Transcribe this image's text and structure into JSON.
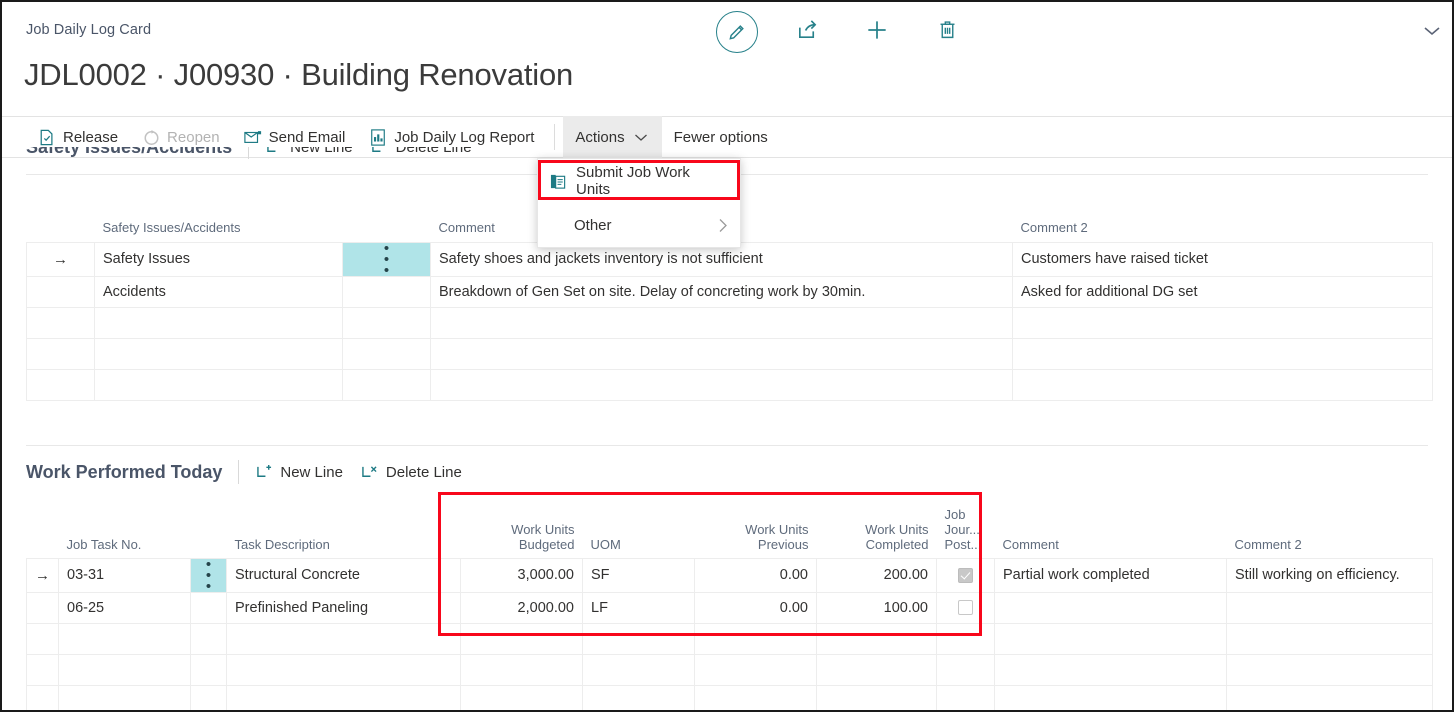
{
  "header": {
    "breadcrumb": "Job Daily Log Card",
    "title": "JDL0002 · J00930 · Building Renovation",
    "icons": [
      {
        "name": "edit-icon",
        "label": "Edit"
      },
      {
        "name": "share-icon",
        "label": "Share"
      },
      {
        "name": "plus-icon",
        "label": "New"
      },
      {
        "name": "trash-icon",
        "label": "Delete"
      }
    ],
    "collapse_icon": "chevron-down-icon"
  },
  "ribbon": {
    "items": [
      {
        "label": "Release",
        "icon": "release-icon",
        "disabled": false
      },
      {
        "label": "Reopen",
        "icon": "reopen-icon",
        "disabled": true
      },
      {
        "label": "Send Email",
        "icon": "email-icon",
        "disabled": false
      },
      {
        "label": "Job Daily Log Report",
        "icon": "report-icon",
        "disabled": false
      }
    ],
    "actions_label": "Actions",
    "fewer_options_label": "Fewer options"
  },
  "actions_menu": {
    "items": [
      {
        "label": "Submit Job Work Units",
        "icon": "submit-document-icon",
        "highlighted": true,
        "has_submenu": false
      },
      {
        "label": "Other",
        "icon": "",
        "highlighted": false,
        "has_submenu": true
      }
    ],
    "highlight_color": "#f8071b"
  },
  "safety_section": {
    "title": "Safety Issues/Accidents",
    "new_line_label": "New Line",
    "delete_line_label": "Delete Line",
    "columns": [
      "",
      "Safety Issues/Accidents",
      "",
      "Comment",
      "Comment 2"
    ],
    "rows": [
      {
        "selected": true,
        "issue": "Safety Issues",
        "comment": "Safety shoes and jackets inventory is not sufficient",
        "comment2": "Customers have raised ticket"
      },
      {
        "selected": false,
        "issue": "Accidents",
        "comment": "Breakdown of Gen Set on site. Delay of concreting work by 30min.",
        "comment2": "Asked for additional DG set"
      },
      {
        "selected": false,
        "issue": "",
        "comment": "",
        "comment2": ""
      },
      {
        "selected": false,
        "issue": "",
        "comment": "",
        "comment2": ""
      },
      {
        "selected": false,
        "issue": "",
        "comment": "",
        "comment2": ""
      }
    ]
  },
  "work_section": {
    "title": "Work Performed Today",
    "new_line_label": "New Line",
    "delete_line_label": "Delete Line",
    "columns": {
      "job_task_no": "Job Task No.",
      "task_description": "Task Description",
      "work_units_budgeted": "Work Units\nBudgeted",
      "work_units_budgeted_l1": "Work Units",
      "work_units_budgeted_l2": "Budgeted",
      "uom": "UOM",
      "work_units_previous_l1": "Work Units",
      "work_units_previous_l2": "Previous",
      "work_units_completed_l1": "Work Units",
      "work_units_completed_l2": "Completed",
      "job_journal_posted_l1": "Job",
      "job_journal_posted_l2": "Jour...",
      "job_journal_posted_l3": "Post...",
      "comment": "Comment",
      "comment2": "Comment 2"
    },
    "rows": [
      {
        "selected": true,
        "job_task_no": "03-31",
        "task_description": "Structural Concrete",
        "work_units_budgeted": "3,000.00",
        "uom": "SF",
        "work_units_previous": "0.00",
        "work_units_completed": "200.00",
        "job_journal_posted": true,
        "comment": "Partial work completed",
        "comment2": "Still working on efficiency."
      },
      {
        "selected": false,
        "job_task_no": "06-25",
        "task_description": "Prefinished Paneling",
        "work_units_budgeted": "2,000.00",
        "uom": "LF",
        "work_units_previous": "0.00",
        "work_units_completed": "100.00",
        "job_journal_posted": false,
        "comment": "",
        "comment2": ""
      },
      {
        "selected": false,
        "job_task_no": "",
        "task_description": "",
        "work_units_budgeted": "",
        "uom": "",
        "work_units_previous": "",
        "work_units_completed": "",
        "job_journal_posted": null,
        "comment": "",
        "comment2": ""
      },
      {
        "selected": false,
        "job_task_no": "",
        "task_description": "",
        "work_units_budgeted": "",
        "uom": "",
        "work_units_previous": "",
        "work_units_completed": "",
        "job_journal_posted": null,
        "comment": "",
        "comment2": ""
      },
      {
        "selected": false,
        "job_task_no": "",
        "task_description": "",
        "work_units_budgeted": "",
        "uom": "",
        "work_units_previous": "",
        "work_units_completed": "",
        "job_journal_posted": null,
        "comment": "",
        "comment2": ""
      }
    ],
    "highlight_color": "#f8071b"
  },
  "theme": {
    "accent": "#1d7a84",
    "selected_cell": "#b0e4e8",
    "highlight": "#f8071b",
    "header_text": "#5f6b7c"
  }
}
